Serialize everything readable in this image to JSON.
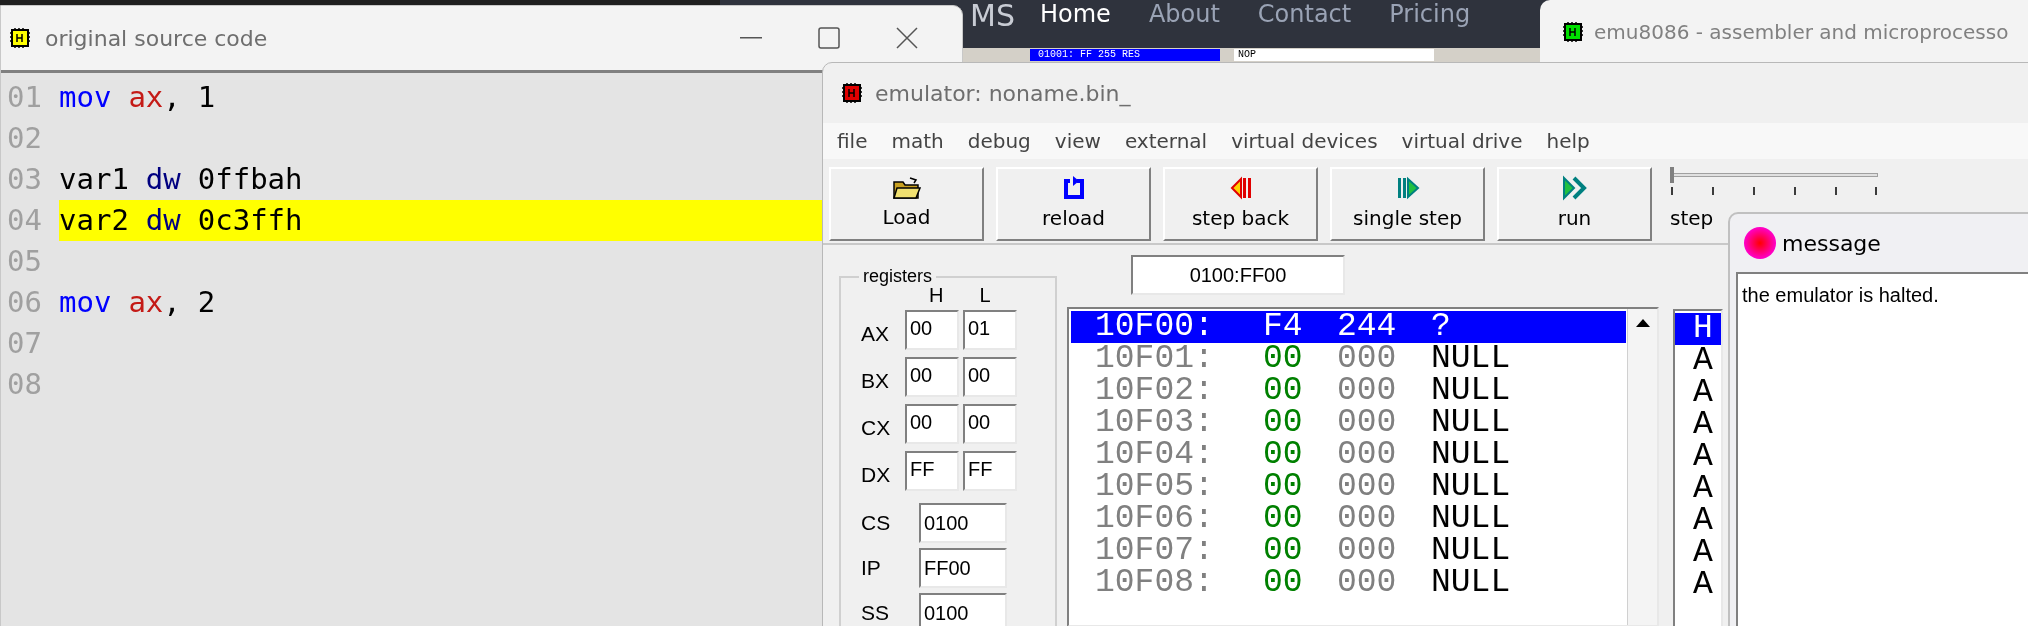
{
  "browser_behind": {
    "logo": "MS",
    "nav": [
      {
        "label": "Home",
        "selected": true
      },
      {
        "label": "About",
        "selected": false
      },
      {
        "label": "Contact",
        "selected": false
      },
      {
        "label": "Pricing",
        "selected": false
      }
    ],
    "peek_row": {
      "memory": "01001: FF 255 RES",
      "code": "NOP"
    }
  },
  "source_window": {
    "title": "original source code",
    "lines": [
      {
        "number": "01",
        "highlighted": false,
        "tokens": [
          {
            "text": "mov",
            "kind": "keyword"
          },
          {
            "text": "ax",
            "kind": "register"
          },
          {
            "text": ",",
            "kind": "punct"
          },
          {
            "text": "1",
            "kind": "plain"
          }
        ]
      },
      {
        "number": "02",
        "highlighted": false
      },
      {
        "number": "03",
        "highlighted": false,
        "tokens": [
          {
            "text": "var1",
            "kind": "plain"
          },
          {
            "text": "dw",
            "kind": "directive"
          },
          {
            "text": "0ffbah",
            "kind": "plain"
          }
        ]
      },
      {
        "number": "04",
        "highlighted": true,
        "tokens": [
          {
            "text": "var2",
            "kind": "plain"
          },
          {
            "text": "dw",
            "kind": "directive"
          },
          {
            "text": "0c3ffh",
            "kind": "plain"
          }
        ]
      },
      {
        "number": "05",
        "highlighted": false
      },
      {
        "number": "06",
        "highlighted": false,
        "tokens": [
          {
            "text": "mov",
            "kind": "keyword"
          },
          {
            "text": "ax",
            "kind": "register"
          },
          {
            "text": ",",
            "kind": "punct"
          },
          {
            "text": "2",
            "kind": "plain"
          }
        ]
      },
      {
        "number": "07",
        "highlighted": false
      },
      {
        "number": "08",
        "highlighted": false
      }
    ]
  },
  "main_window": {
    "title": "emu8086 - assembler and microprocesso"
  },
  "emulator_window": {
    "title": "emulator: noname.bin_",
    "menu": [
      "file",
      "math",
      "debug",
      "view",
      "external",
      "virtual devices",
      "virtual drive",
      "help"
    ],
    "toolbar": [
      {
        "label": "Load",
        "kind": "load"
      },
      {
        "label": "reload",
        "kind": "reload"
      },
      {
        "label": "step back",
        "kind": "back"
      },
      {
        "label": "single step",
        "kind": "step"
      },
      {
        "label": "run",
        "kind": "run"
      }
    ],
    "speed_slider": {
      "level": 0,
      "label": "step"
    },
    "registers": {
      "title": "registers",
      "columns": [
        "H",
        "L"
      ],
      "pairs": [
        {
          "name": "AX",
          "high": "00",
          "low": "01"
        },
        {
          "name": "BX",
          "high": "00",
          "low": "00"
        },
        {
          "name": "CX",
          "high": "00",
          "low": "00"
        },
        {
          "name": "DX",
          "high": "FF",
          "low": "FF"
        }
      ],
      "segments": [
        {
          "name": "CS",
          "value": "0100"
        },
        {
          "name": "IP",
          "value": "FF00"
        },
        {
          "name": "SS",
          "value": "0100"
        }
      ]
    },
    "address": "0100:FF00",
    "memory": [
      {
        "address": "10F00:",
        "hex": "F4",
        "dec": "244",
        "char": "?",
        "selected": true
      },
      {
        "address": "10F01:",
        "hex": "00",
        "dec": "000",
        "char": "NULL",
        "selected": false
      },
      {
        "address": "10F02:",
        "hex": "00",
        "dec": "000",
        "char": "NULL",
        "selected": false
      },
      {
        "address": "10F03:",
        "hex": "00",
        "dec": "000",
        "char": "NULL",
        "selected": false
      },
      {
        "address": "10F04:",
        "hex": "00",
        "dec": "000",
        "char": "NULL",
        "selected": false
      },
      {
        "address": "10F05:",
        "hex": "00",
        "dec": "000",
        "char": "NULL",
        "selected": false
      },
      {
        "address": "10F06:",
        "hex": "00",
        "dec": "000",
        "char": "NULL",
        "selected": false
      },
      {
        "address": "10F07:",
        "hex": "00",
        "dec": "000",
        "char": "NULL",
        "selected": false
      },
      {
        "address": "10F08:",
        "hex": "00",
        "dec": "000",
        "char": "NULL",
        "selected": false
      }
    ],
    "disassembly": [
      {
        "text": "H",
        "selected": true
      },
      {
        "text": "A",
        "selected": false
      },
      {
        "text": "A",
        "selected": false
      },
      {
        "text": "A",
        "selected": false
      },
      {
        "text": "A",
        "selected": false
      },
      {
        "text": "A",
        "selected": false
      },
      {
        "text": "A",
        "selected": false
      },
      {
        "text": "A",
        "selected": false
      },
      {
        "text": "A",
        "selected": false
      }
    ]
  },
  "message_window": {
    "title": "message",
    "text": "the emulator is halted."
  }
}
